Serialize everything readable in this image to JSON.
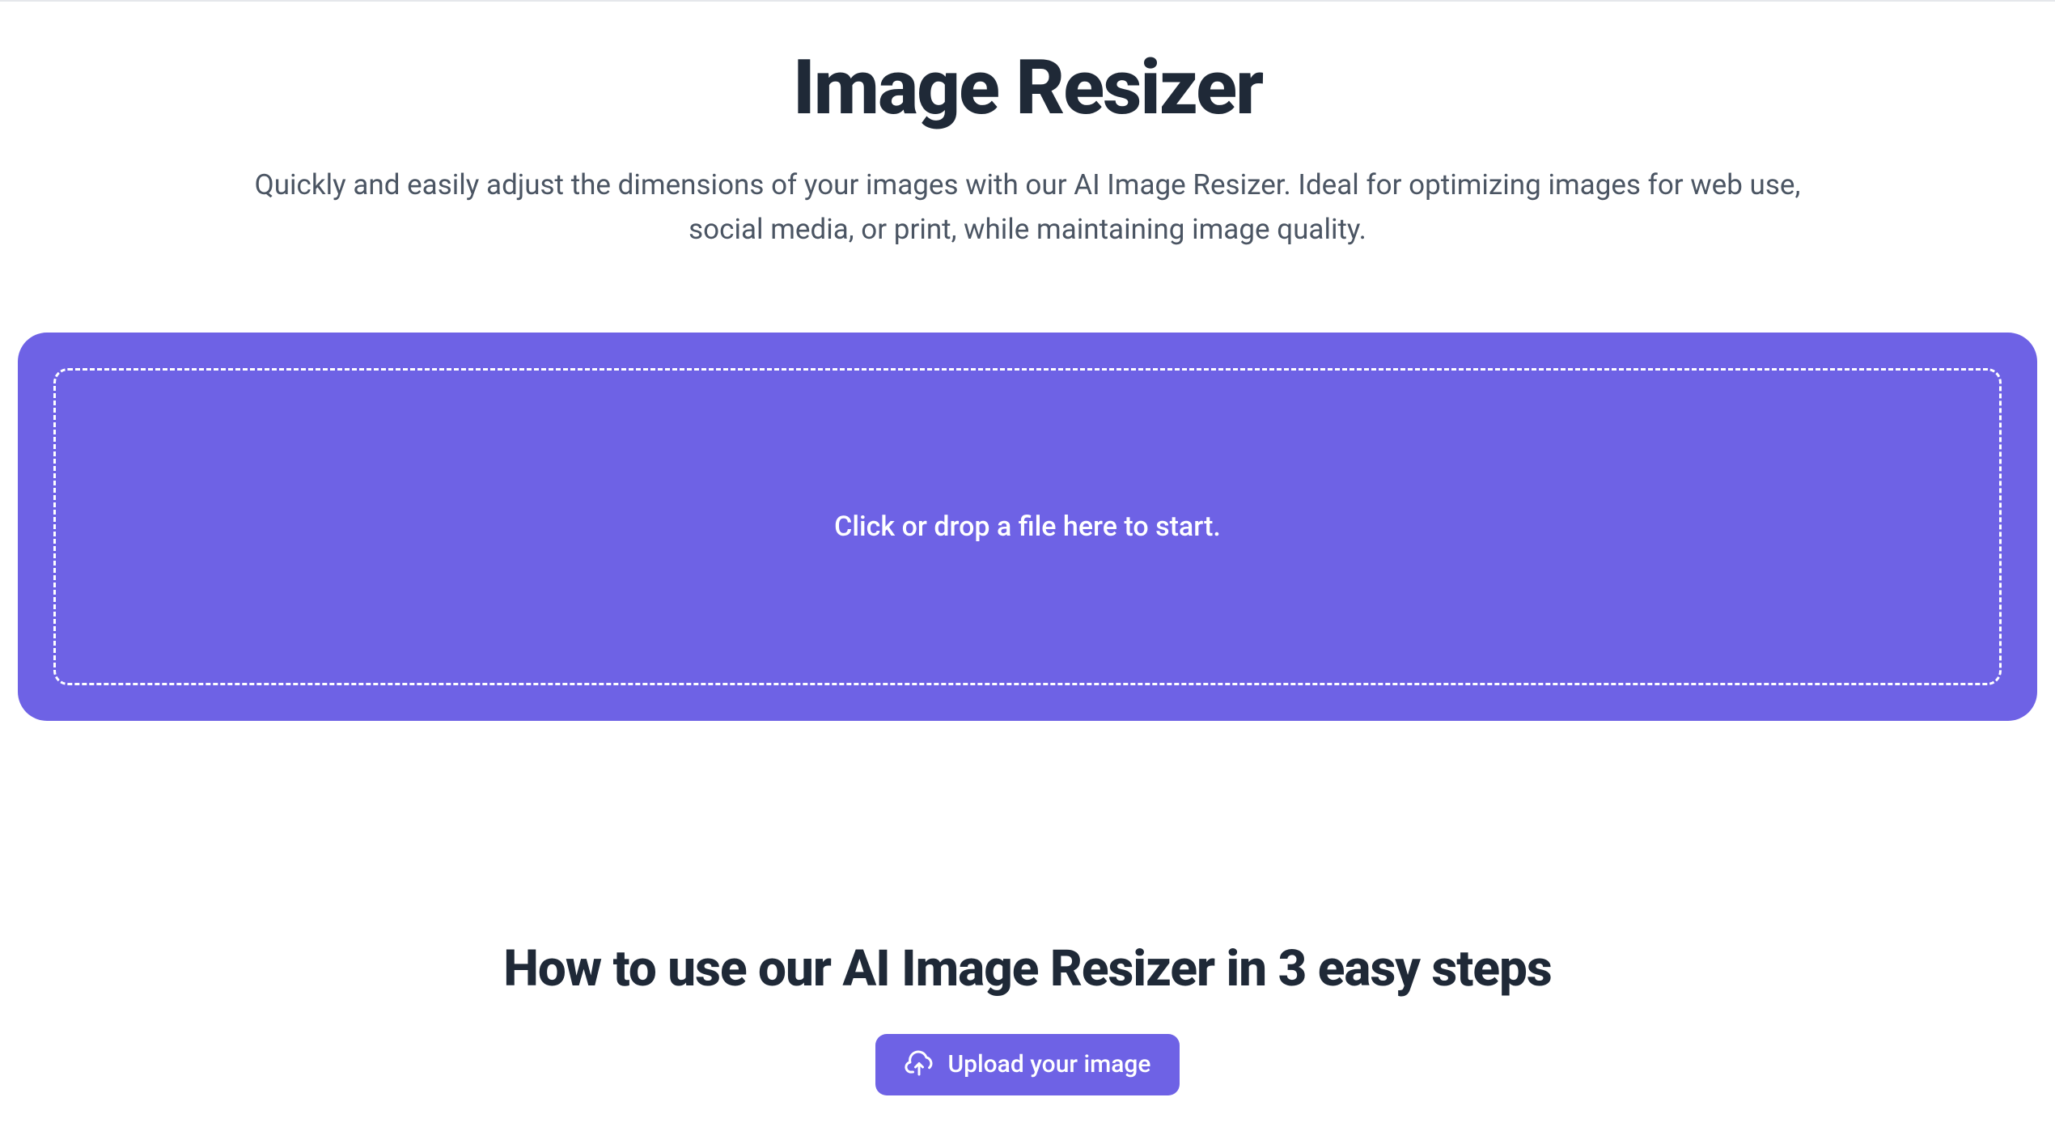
{
  "hero": {
    "title": "Image Resizer",
    "subtitle": "Quickly and easily adjust the dimensions of your images with our AI Image Resizer. Ideal for optimizing images for web use, social media, or print, while maintaining image quality."
  },
  "dropzone": {
    "prompt": "Click or drop a file here to start."
  },
  "howto": {
    "title": "How to use our AI Image Resizer in 3 easy steps"
  },
  "upload_button": {
    "label": "Upload your image"
  },
  "colors": {
    "accent": "#6e62e5",
    "text_primary": "#1f2937",
    "text_secondary": "#4b5563"
  }
}
